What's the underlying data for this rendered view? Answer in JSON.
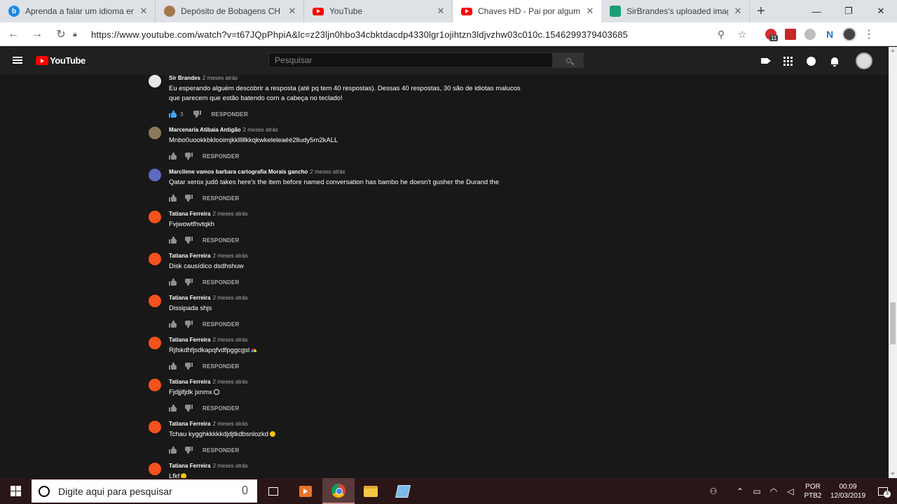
{
  "browser": {
    "tabs": [
      {
        "title": "Aprenda a falar um idioma em",
        "icon": "bing-icon",
        "active": false
      },
      {
        "title": "Depósito de Bobagens CH • Fó",
        "icon": "site-icon",
        "active": false
      },
      {
        "title": "YouTube",
        "icon": "youtube-icon",
        "active": false
      },
      {
        "title": "Chaves HD - Pai por algumas h",
        "icon": "youtube-icon",
        "active": true
      },
      {
        "title": "SirBrandes's uploaded images",
        "icon": "imageshack-icon",
        "active": false
      }
    ],
    "url": "https://www.youtube.com/watch?v=t67JQpPhpiA&lc=z23ljn0hbo34cbktdacdp4330lgr1ojihtzn3ldjvzhw03c010c.1546299379403685",
    "extension_badge": "11"
  },
  "youtube": {
    "logo_text": "YouTube",
    "search_placeholder": "Pesquisar"
  },
  "comments": [
    {
      "author": "Sir Brandes",
      "time": "2 meses atrás",
      "lines": [
        "Eu esperando alguém descobrir a resposta (até pq tem 40 respostas). Dessas 40 respostas, 30 são de idiotas malucos",
        "que parecem que estão batendo com a cabeça no teclado!"
      ],
      "likes": "3",
      "liked": true,
      "avatar_color": "#e8e8e8",
      "reply": "RESPONDER"
    },
    {
      "author": "Marcenaria Atibaia Antigão",
      "time": "2 meses atrás",
      "lines": [
        "Mnbo0uookkbklooimjkklllllkkqkwkeleleaéé2lludy5m2kALL"
      ],
      "likes": "",
      "liked": false,
      "avatar_color": "#8a7a5a",
      "reply": "RESPONDER"
    },
    {
      "author": "Marcilene vamos barbara cartografia Morais gancho",
      "time": "2 meses atrás",
      "lines": [
        "Qatar xerox judô takes here's the item before named conversation has bambo he doesn't gusher the Durand the"
      ],
      "likes": "",
      "liked": false,
      "avatar_color": "#5c6bc0",
      "reply": "RESPONDER"
    },
    {
      "author": "Tatiana Ferreira",
      "time": "2 meses atrás",
      "lines": [
        "Fvjwowtfhvtqkh"
      ],
      "likes": "",
      "liked": false,
      "avatar_color": "#f4511e",
      "reply": "RESPONDER"
    },
    {
      "author": "Tatiana Ferreira",
      "time": "2 meses atrás",
      "lines": [
        "Disk causídico dsdhshuw"
      ],
      "likes": "",
      "liked": false,
      "avatar_color": "#f4511e",
      "reply": "RESPONDER"
    },
    {
      "author": "Tatiana Ferreira",
      "time": "2 meses atrás",
      "lines": [
        "Dissipada shjs"
      ],
      "likes": "",
      "liked": false,
      "avatar_color": "#f4511e",
      "reply": "RESPONDER"
    },
    {
      "author": "Tatiana Ferreira",
      "time": "2 meses atrás",
      "lines": [
        "Rjfskdhfjsdkapqfvdfpggcgsl"
      ],
      "emoji": "rainbow",
      "likes": "",
      "liked": false,
      "avatar_color": "#f4511e",
      "reply": "RESPONDER"
    },
    {
      "author": "Tatiana Ferreira",
      "time": "2 meses atrás",
      "lines": [
        "Fjdjjifjdk jxnmx"
      ],
      "emoji": "outline",
      "likes": "",
      "liked": false,
      "avatar_color": "#f4511e",
      "reply": "RESPONDER"
    },
    {
      "author": "Tatiana Ferreira",
      "time": "2 meses atrás",
      "lines": [
        "Tchau kygghkkkkkdjdjtkdbsnlozkd"
      ],
      "emoji": "face",
      "likes": "",
      "liked": false,
      "avatar_color": "#f4511e",
      "reply": "RESPONDER"
    },
    {
      "author": "Tatiana Ferreira",
      "time": "2 meses atrás",
      "lines": [
        "Lfkf"
      ],
      "emoji": "face",
      "likes": "",
      "liked": false,
      "avatar_color": "#f4511e",
      "reply": "RESPONDER"
    }
  ],
  "taskbar": {
    "search_placeholder": "Digite aqui para pesquisar",
    "language": "POR",
    "keyboard": "PTB2",
    "time": "00:09",
    "date": "12/03/2019",
    "notification_count": "3"
  }
}
